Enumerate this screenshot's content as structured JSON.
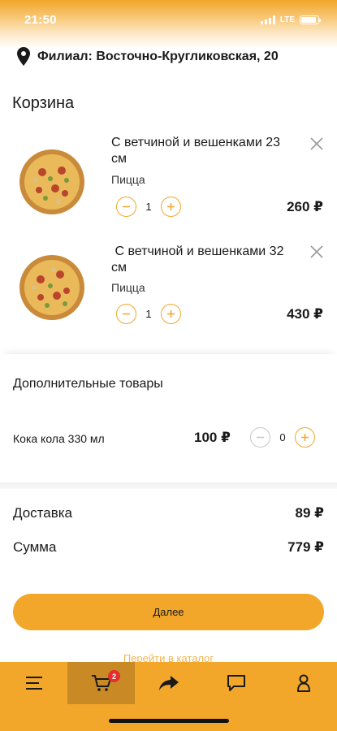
{
  "status_bar": {
    "time": "21:50",
    "network": "LTE"
  },
  "branch": {
    "label": "Филиал: Восточно-Кругликовская, 20"
  },
  "cart": {
    "title": "Корзина",
    "items": [
      {
        "name": "С ветчиной и вешенками 23 см",
        "category": "Пицца",
        "quantity": "1",
        "price": "260 ₽"
      },
      {
        "name": " С ветчиной и вешенками 32 см",
        "category": "Пицца",
        "quantity": "1",
        "price": "430 ₽"
      }
    ]
  },
  "extras": {
    "title": "Дополнительные товары",
    "items": [
      {
        "name": "Кока кола 330 мл",
        "price": "100 ₽",
        "quantity": "0"
      }
    ]
  },
  "totals": {
    "delivery_label": "Доставка",
    "delivery_value": "89 ₽",
    "sum_label": "Сумма",
    "sum_value": "779 ₽"
  },
  "actions": {
    "next_label": "Далее",
    "catalog_link": "Перейти в каталог"
  },
  "tabbar": {
    "tabs": [
      {
        "icon": "menu-icon"
      },
      {
        "icon": "cart-icon",
        "badge": "2",
        "active": true
      },
      {
        "icon": "share-icon"
      },
      {
        "icon": "chat-icon"
      },
      {
        "icon": "profile-icon"
      }
    ]
  },
  "colors": {
    "accent": "#f2a62a",
    "accent_dark": "#c98a26",
    "badge": "#e52e2e",
    "link": "#f2b452"
  }
}
